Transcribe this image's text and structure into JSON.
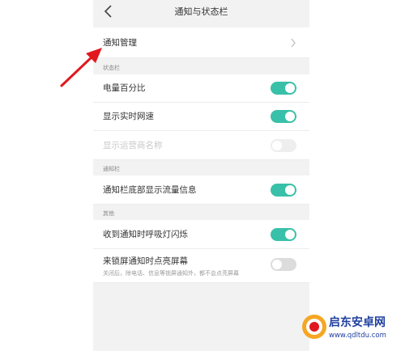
{
  "header": {
    "title": "通知与状态栏",
    "back_icon": "chevron-left-icon"
  },
  "notification_management": {
    "label": "通知管理",
    "chevron_icon": "chevron-right-icon"
  },
  "sections": {
    "status_bar": "状态栏",
    "notification_bar": "通知栏",
    "other": "其他"
  },
  "settings": {
    "battery_percentage": {
      "label": "电量百分比",
      "state": "on"
    },
    "realtime_speed": {
      "label": "显示实时网速",
      "state": "on"
    },
    "carrier_name": {
      "label": "显示运营商名称",
      "state": "disabled"
    },
    "notif_traffic": {
      "label": "通知栏底部显示流量信息",
      "state": "on"
    },
    "breathing_light": {
      "label": "收到通知时呼吸灯闪烁",
      "state": "on"
    },
    "lockscreen_wake": {
      "label": "来锁屏通知时点亮屏幕",
      "description": "关闭后，除电话、信息等锁屏通知外，都不会点亮屏幕",
      "state": "off"
    }
  },
  "annotation": {
    "arrow_color": "#e0191f"
  },
  "colors": {
    "toggle_on": "#39c0a8",
    "toggle_off": "#dcdcdc",
    "background": "#f2f2f2"
  },
  "watermark": {
    "title": "启东安卓网",
    "url": "www.qdltdu.com"
  }
}
